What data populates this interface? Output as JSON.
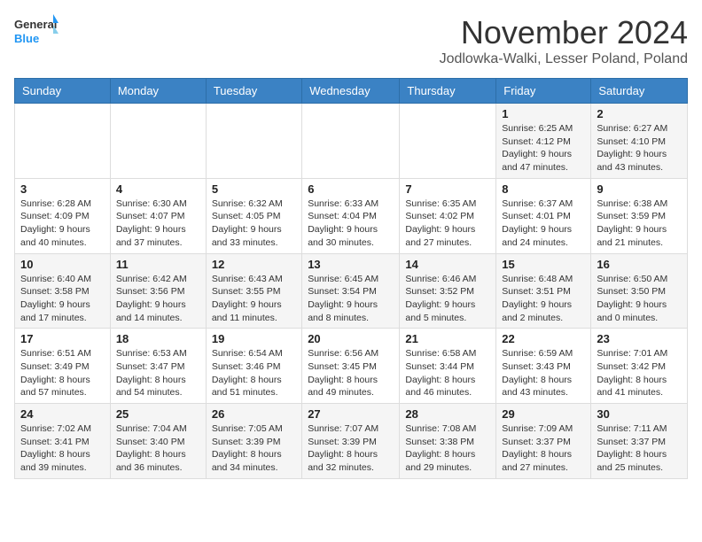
{
  "logo": {
    "line1": "General",
    "line2": "Blue"
  },
  "header": {
    "month": "November 2024",
    "location": "Jodlowka-Walki, Lesser Poland, Poland"
  },
  "weekdays": [
    "Sunday",
    "Monday",
    "Tuesday",
    "Wednesday",
    "Thursday",
    "Friday",
    "Saturday"
  ],
  "weeks": [
    [
      {
        "day": "",
        "info": ""
      },
      {
        "day": "",
        "info": ""
      },
      {
        "day": "",
        "info": ""
      },
      {
        "day": "",
        "info": ""
      },
      {
        "day": "",
        "info": ""
      },
      {
        "day": "1",
        "info": "Sunrise: 6:25 AM\nSunset: 4:12 PM\nDaylight: 9 hours and 47 minutes."
      },
      {
        "day": "2",
        "info": "Sunrise: 6:27 AM\nSunset: 4:10 PM\nDaylight: 9 hours and 43 minutes."
      }
    ],
    [
      {
        "day": "3",
        "info": "Sunrise: 6:28 AM\nSunset: 4:09 PM\nDaylight: 9 hours and 40 minutes."
      },
      {
        "day": "4",
        "info": "Sunrise: 6:30 AM\nSunset: 4:07 PM\nDaylight: 9 hours and 37 minutes."
      },
      {
        "day": "5",
        "info": "Sunrise: 6:32 AM\nSunset: 4:05 PM\nDaylight: 9 hours and 33 minutes."
      },
      {
        "day": "6",
        "info": "Sunrise: 6:33 AM\nSunset: 4:04 PM\nDaylight: 9 hours and 30 minutes."
      },
      {
        "day": "7",
        "info": "Sunrise: 6:35 AM\nSunset: 4:02 PM\nDaylight: 9 hours and 27 minutes."
      },
      {
        "day": "8",
        "info": "Sunrise: 6:37 AM\nSunset: 4:01 PM\nDaylight: 9 hours and 24 minutes."
      },
      {
        "day": "9",
        "info": "Sunrise: 6:38 AM\nSunset: 3:59 PM\nDaylight: 9 hours and 21 minutes."
      }
    ],
    [
      {
        "day": "10",
        "info": "Sunrise: 6:40 AM\nSunset: 3:58 PM\nDaylight: 9 hours and 17 minutes."
      },
      {
        "day": "11",
        "info": "Sunrise: 6:42 AM\nSunset: 3:56 PM\nDaylight: 9 hours and 14 minutes."
      },
      {
        "day": "12",
        "info": "Sunrise: 6:43 AM\nSunset: 3:55 PM\nDaylight: 9 hours and 11 minutes."
      },
      {
        "day": "13",
        "info": "Sunrise: 6:45 AM\nSunset: 3:54 PM\nDaylight: 9 hours and 8 minutes."
      },
      {
        "day": "14",
        "info": "Sunrise: 6:46 AM\nSunset: 3:52 PM\nDaylight: 9 hours and 5 minutes."
      },
      {
        "day": "15",
        "info": "Sunrise: 6:48 AM\nSunset: 3:51 PM\nDaylight: 9 hours and 2 minutes."
      },
      {
        "day": "16",
        "info": "Sunrise: 6:50 AM\nSunset: 3:50 PM\nDaylight: 9 hours and 0 minutes."
      }
    ],
    [
      {
        "day": "17",
        "info": "Sunrise: 6:51 AM\nSunset: 3:49 PM\nDaylight: 8 hours and 57 minutes."
      },
      {
        "day": "18",
        "info": "Sunrise: 6:53 AM\nSunset: 3:47 PM\nDaylight: 8 hours and 54 minutes."
      },
      {
        "day": "19",
        "info": "Sunrise: 6:54 AM\nSunset: 3:46 PM\nDaylight: 8 hours and 51 minutes."
      },
      {
        "day": "20",
        "info": "Sunrise: 6:56 AM\nSunset: 3:45 PM\nDaylight: 8 hours and 49 minutes."
      },
      {
        "day": "21",
        "info": "Sunrise: 6:58 AM\nSunset: 3:44 PM\nDaylight: 8 hours and 46 minutes."
      },
      {
        "day": "22",
        "info": "Sunrise: 6:59 AM\nSunset: 3:43 PM\nDaylight: 8 hours and 43 minutes."
      },
      {
        "day": "23",
        "info": "Sunrise: 7:01 AM\nSunset: 3:42 PM\nDaylight: 8 hours and 41 minutes."
      }
    ],
    [
      {
        "day": "24",
        "info": "Sunrise: 7:02 AM\nSunset: 3:41 PM\nDaylight: 8 hours and 39 minutes."
      },
      {
        "day": "25",
        "info": "Sunrise: 7:04 AM\nSunset: 3:40 PM\nDaylight: 8 hours and 36 minutes."
      },
      {
        "day": "26",
        "info": "Sunrise: 7:05 AM\nSunset: 3:39 PM\nDaylight: 8 hours and 34 minutes."
      },
      {
        "day": "27",
        "info": "Sunrise: 7:07 AM\nSunset: 3:39 PM\nDaylight: 8 hours and 32 minutes."
      },
      {
        "day": "28",
        "info": "Sunrise: 7:08 AM\nSunset: 3:38 PM\nDaylight: 8 hours and 29 minutes."
      },
      {
        "day": "29",
        "info": "Sunrise: 7:09 AM\nSunset: 3:37 PM\nDaylight: 8 hours and 27 minutes."
      },
      {
        "day": "30",
        "info": "Sunrise: 7:11 AM\nSunset: 3:37 PM\nDaylight: 8 hours and 25 minutes."
      }
    ]
  ]
}
